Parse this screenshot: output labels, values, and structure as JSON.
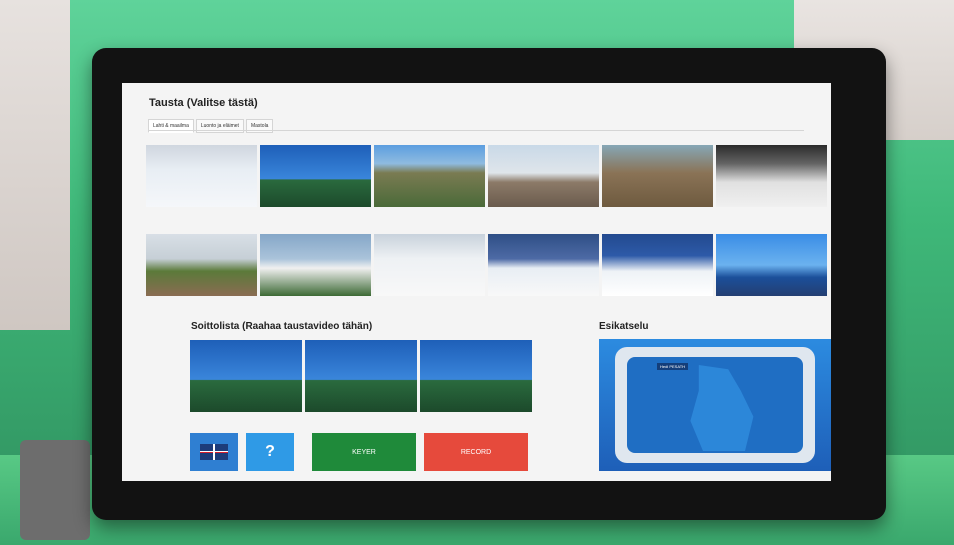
{
  "header": {
    "title": "Tausta (Valitse tästä)",
    "tabs": [
      {
        "label": "Lahti & maailma"
      },
      {
        "label": "Luonto ja eläimet"
      },
      {
        "label": "Mastola"
      }
    ],
    "active_tab": "Lahti & maailma"
  },
  "backgrounds": {
    "thumbnails_row1": [
      "snow-field",
      "ski-jump",
      "city-aerial",
      "palace",
      "harbor-cranes",
      "snowy-road"
    ],
    "thumbnails_row2": [
      "taj-mahal",
      "white-house",
      "ice-rink",
      "ice-rink-goal-area",
      "hockey-goal",
      "tower-coast"
    ]
  },
  "playlist": {
    "title": "Soittolista (Raahaa taustavideo tähän)",
    "thumbnails": [
      "ski-jump",
      "ski-jump",
      "ski-jump"
    ]
  },
  "preview": {
    "title": "Esikatselu",
    "map_label": "Hedi PESATH"
  },
  "controls": {
    "language_icon": "uk-flag-icon",
    "help_label": "?",
    "keyer_label": "KEYER",
    "record_label": "RECORD"
  }
}
